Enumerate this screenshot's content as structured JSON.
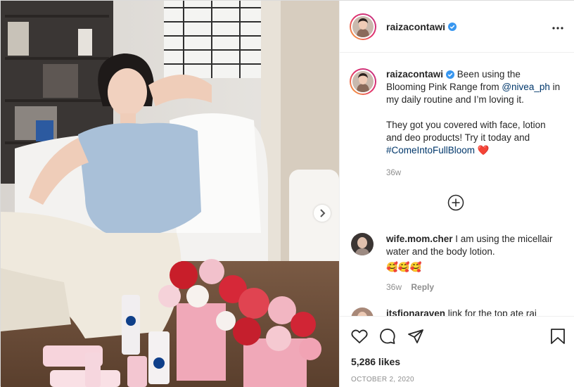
{
  "post": {
    "author": "raizacontawi",
    "more_icon": "more-horizontal-icon"
  },
  "caption": {
    "author": "raizacontawi",
    "line1": "Been using the Blooming Pink Range from",
    "mention": "@nivea_ph",
    "line2": "in my daily routine and I’m loving it.",
    "line3": "They got you covered with face, lotion and deo products! Try it today and",
    "hashtag": "#ComeIntoFullBloom",
    "heart": "❤️",
    "time": "36w"
  },
  "comments": [
    {
      "author": "wife.mom.cher",
      "text": "I am using the micellair water and the body lotion.",
      "emojis": "🥰🥰🥰",
      "time": "36w",
      "reply": "Reply"
    },
    {
      "author": "itsfionaraven",
      "text": "link for the top ate rai"
    }
  ],
  "footer": {
    "likes": "5,286 likes",
    "date": "OCTOBER 2, 2020"
  },
  "colors": {
    "link": "#00376b",
    "verified": "#3897f0",
    "muted": "#8e8e8e"
  }
}
